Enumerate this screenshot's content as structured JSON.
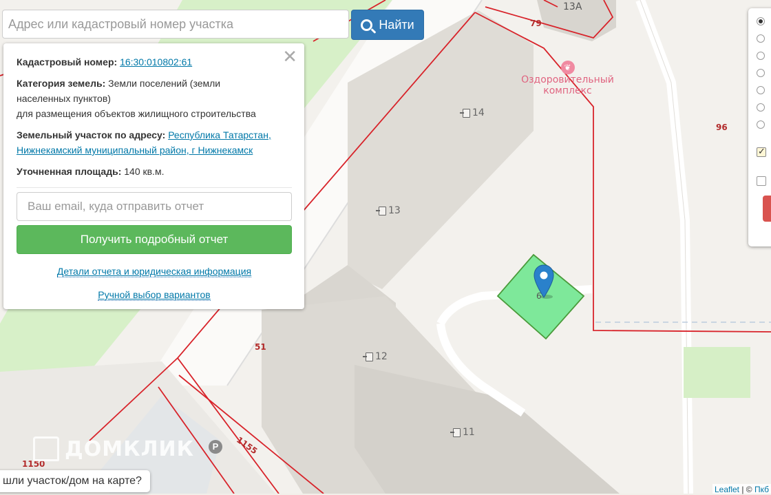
{
  "search": {
    "placeholder": "Адрес или кадастровый номер участка",
    "button_label": "Найти"
  },
  "popup": {
    "close_symbol": "✕",
    "cadastral_label": "Кадастровый номер:",
    "cadastral_number": "16:30:010802:61",
    "category_label": "Категория земель:",
    "category_value_line1": "Земли поселений (земли",
    "category_value_line2": "населенных пунктов)",
    "category_value_line3": "для размещения объектов жилищного строительства",
    "address_label": "Земельный участок по адресу:",
    "address_line1": "Республика Татарстан,",
    "address_line2": "Нижнекамский муниципальный район, г Нижнекамск",
    "area_label": "Уточненная площадь:",
    "area_value": "140 кв.м.",
    "email_placeholder": "Ваш email, куда отправить отчет",
    "report_button": "Получить подробный отчет",
    "details_link": "Детали отчета и юридическая информация",
    "manual_link": "Ручной выбор вариантов"
  },
  "map": {
    "poi_line1": "Оздоровительный",
    "poi_line2": "комплекс",
    "watermark": "ДОМКЛИК",
    "parking": "P",
    "parcel_number": "6",
    "building_numbers": [
      "13А",
      "14",
      "13",
      "12",
      "11"
    ],
    "cadastral_labels": [
      "79",
      "96",
      "51",
      "1155",
      "1150"
    ]
  },
  "layers": {
    "radios": [
      true,
      false,
      false,
      false,
      false,
      false,
      false
    ],
    "checkboxes": [
      true,
      false
    ]
  },
  "toast": "шли участок/дом на карте?",
  "attribution": {
    "leaflet": "Leaflet",
    "separator": " | © ",
    "provider": "Пкб"
  },
  "colors": {
    "primary_button": "#337ab7",
    "success_button": "#5cb85c",
    "parcel_fill": "#7ee89a",
    "boundary": "#d8232a",
    "marker": "#2a81cb"
  }
}
